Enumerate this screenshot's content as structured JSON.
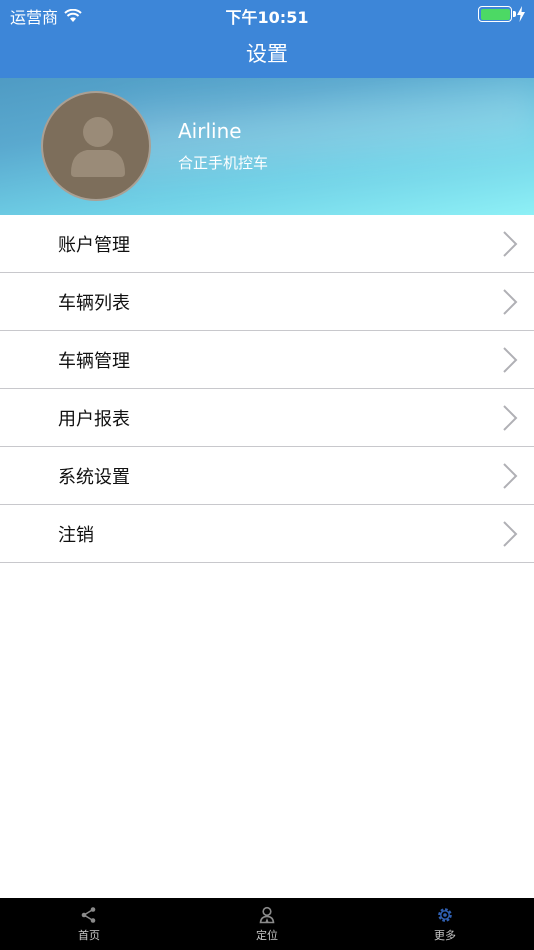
{
  "status_bar": {
    "carrier": "运营商",
    "time": "下午10:51",
    "battery_level": 1.0
  },
  "header": {
    "title": "设置"
  },
  "profile": {
    "name": "Airline",
    "subtitle": "合正手机控车"
  },
  "menu": {
    "items": [
      {
        "label": "账户管理"
      },
      {
        "label": "车辆列表"
      },
      {
        "label": "车辆管理"
      },
      {
        "label": "用户报表"
      },
      {
        "label": "系统设置"
      },
      {
        "label": "注销"
      }
    ]
  },
  "tabbar": {
    "items": [
      {
        "label": "首页",
        "icon": "share-icon"
      },
      {
        "label": "定位",
        "icon": "user-locate-icon"
      },
      {
        "label": "更多",
        "icon": "gear-icon"
      }
    ],
    "active_index": 2
  },
  "colors": {
    "primary": "#3d86d8",
    "active_tab_icon": "#2f5fb0",
    "inactive_tab_icon": "#8a8a8a"
  }
}
